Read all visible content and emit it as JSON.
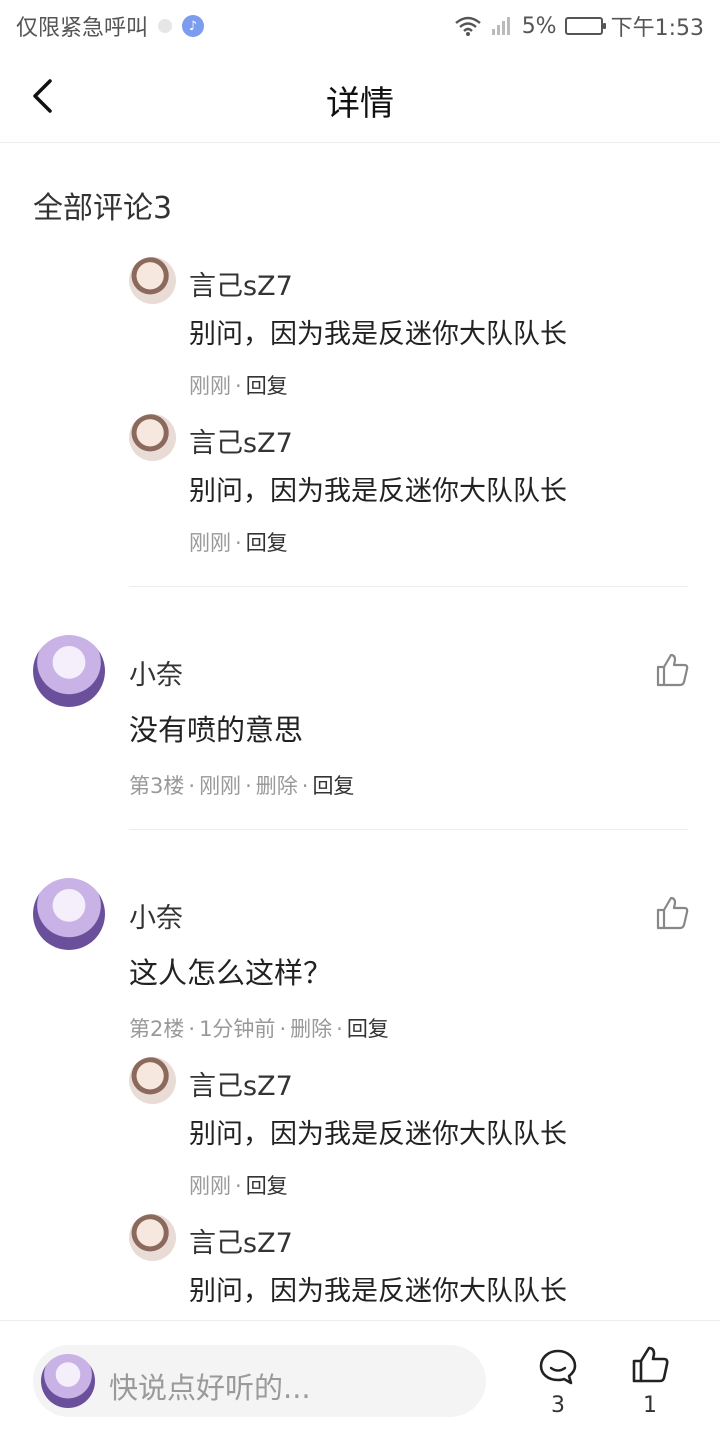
{
  "status_bar": {
    "left_text": "仅限紧急呼叫",
    "battery_pct": "5%",
    "time": "下午1:53"
  },
  "nav": {
    "title": "详情"
  },
  "section": {
    "title": "全部评论3"
  },
  "top_replies": [
    {
      "name": "言己sZ7",
      "content": "别问，因为我是反迷你大队队长",
      "time": "刚刚",
      "reply": "回复"
    },
    {
      "name": "言己sZ7",
      "content": "别问，因为我是反迷你大队队长",
      "time": "刚刚",
      "reply": "回复"
    }
  ],
  "comments": [
    {
      "name": "小奈",
      "content": "没有喷的意思",
      "floor": "第3楼",
      "time": "刚刚",
      "delete": "删除",
      "reply": "回复"
    },
    {
      "name": "小奈",
      "content": "这人怎么这样？",
      "floor": "第2楼",
      "time": "1分钟前",
      "delete": "删除",
      "reply": "回复",
      "replies": [
        {
          "name": "言己sZ7",
          "content": "别问，因为我是反迷你大队队长",
          "time": "刚刚",
          "reply": "回复"
        },
        {
          "name": "言己sZ7",
          "content": "别问，因为我是反迷你大队队长"
        }
      ]
    }
  ],
  "bottom_bar": {
    "placeholder": "快说点好听的...",
    "comment_count": "3",
    "like_count": "1"
  }
}
